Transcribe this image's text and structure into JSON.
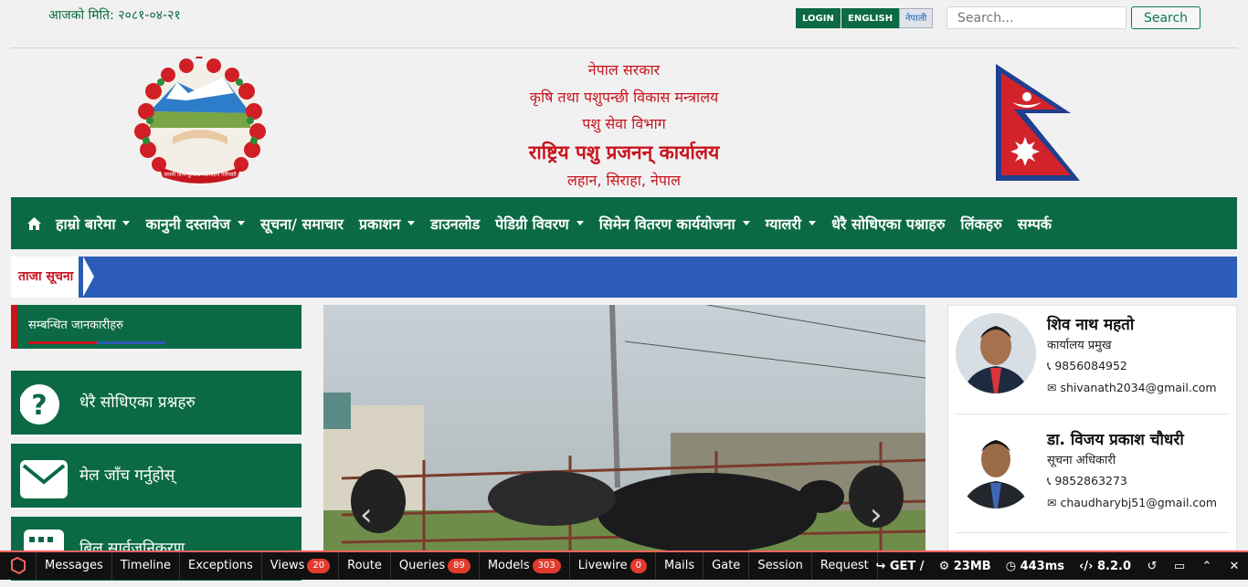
{
  "topbar": {
    "date": "आजको मिति: २०८१-०४-२१",
    "login": "LOGIN",
    "english": "ENGLISH",
    "nepali": "नेपाली",
    "search_placeholder": "Search...",
    "search_button": "Search"
  },
  "header": {
    "line1": "नेपाल सरकार",
    "line2": "कृषि तथा पशुपन्छी विकास मन्त्रालय",
    "line3": "पशु सेवा विभाग",
    "office": "राष्ट्रिय पशु प्रजनन् कार्यालय",
    "address": "लहान, सिराहा, नेपाल",
    "emblem_motto": "जननी जन्मभूमिश्च स्वर्गादपि गरीयसी"
  },
  "nav": [
    {
      "label": "हाम्रो बारेमा",
      "dropdown": true
    },
    {
      "label": "कानुनी दस्तावेज",
      "dropdown": true
    },
    {
      "label": "सूचना/ समाचार",
      "dropdown": false
    },
    {
      "label": "प्रकाशन",
      "dropdown": true
    },
    {
      "label": "डाउनलोड",
      "dropdown": false
    },
    {
      "label": "पेडिग्री विवरण",
      "dropdown": true
    },
    {
      "label": "सिमेन वितरण कार्ययोजना",
      "dropdown": true
    },
    {
      "label": "ग्यालरी",
      "dropdown": true
    },
    {
      "label": "धेरै सोधिएका पश्नाहरु",
      "dropdown": false
    },
    {
      "label": "लिंकहरु",
      "dropdown": false
    },
    {
      "label": "सम्पर्क",
      "dropdown": false
    }
  ],
  "ticker": {
    "label": "ताजा सूचना"
  },
  "sidebar": {
    "related_title": "सम्बन्धित जानकारीहरु",
    "cards": [
      {
        "label": "धेरै सोधिएका प्रश्नहरु",
        "icon": "question-circle-icon"
      },
      {
        "label": "मेल जाँच गर्नुहोस्",
        "icon": "envelope-icon"
      },
      {
        "label": "बिल सार्वजनिकरण",
        "icon": "calculator-icon"
      }
    ]
  },
  "slider": {
    "prev": "‹",
    "next": "›"
  },
  "staff": [
    {
      "name": "शिव नाथ महतो",
      "role": "कार्यालय प्रमुख",
      "phone": "9856084952",
      "email": "shivanath2034@gmail.com"
    },
    {
      "name": "डा. विजय प्रकाश चौधरी",
      "role": "सूचना अधिकारी",
      "phone": "9852863273",
      "email": "chaudharybj51@gmail.com"
    }
  ],
  "debugbar": {
    "tabs": [
      {
        "label": "Messages",
        "badge": ""
      },
      {
        "label": "Timeline",
        "badge": ""
      },
      {
        "label": "Exceptions",
        "badge": ""
      },
      {
        "label": "Views",
        "badge": "20"
      },
      {
        "label": "Route",
        "badge": ""
      },
      {
        "label": "Queries",
        "badge": "89"
      },
      {
        "label": "Models",
        "badge": "303"
      },
      {
        "label": "Livewire",
        "badge": "0"
      },
      {
        "label": "Mails",
        "badge": ""
      },
      {
        "label": "Gate",
        "badge": ""
      },
      {
        "label": "Session",
        "badge": ""
      },
      {
        "label": "Request",
        "badge": ""
      }
    ],
    "method": "GET /",
    "memory": "23MB",
    "time": "443ms",
    "php": "8.2.0"
  },
  "colors": {
    "brand_green": "#0b6a45",
    "brand_red": "#c9151e",
    "ticker_blue": "#2b5cb8"
  }
}
